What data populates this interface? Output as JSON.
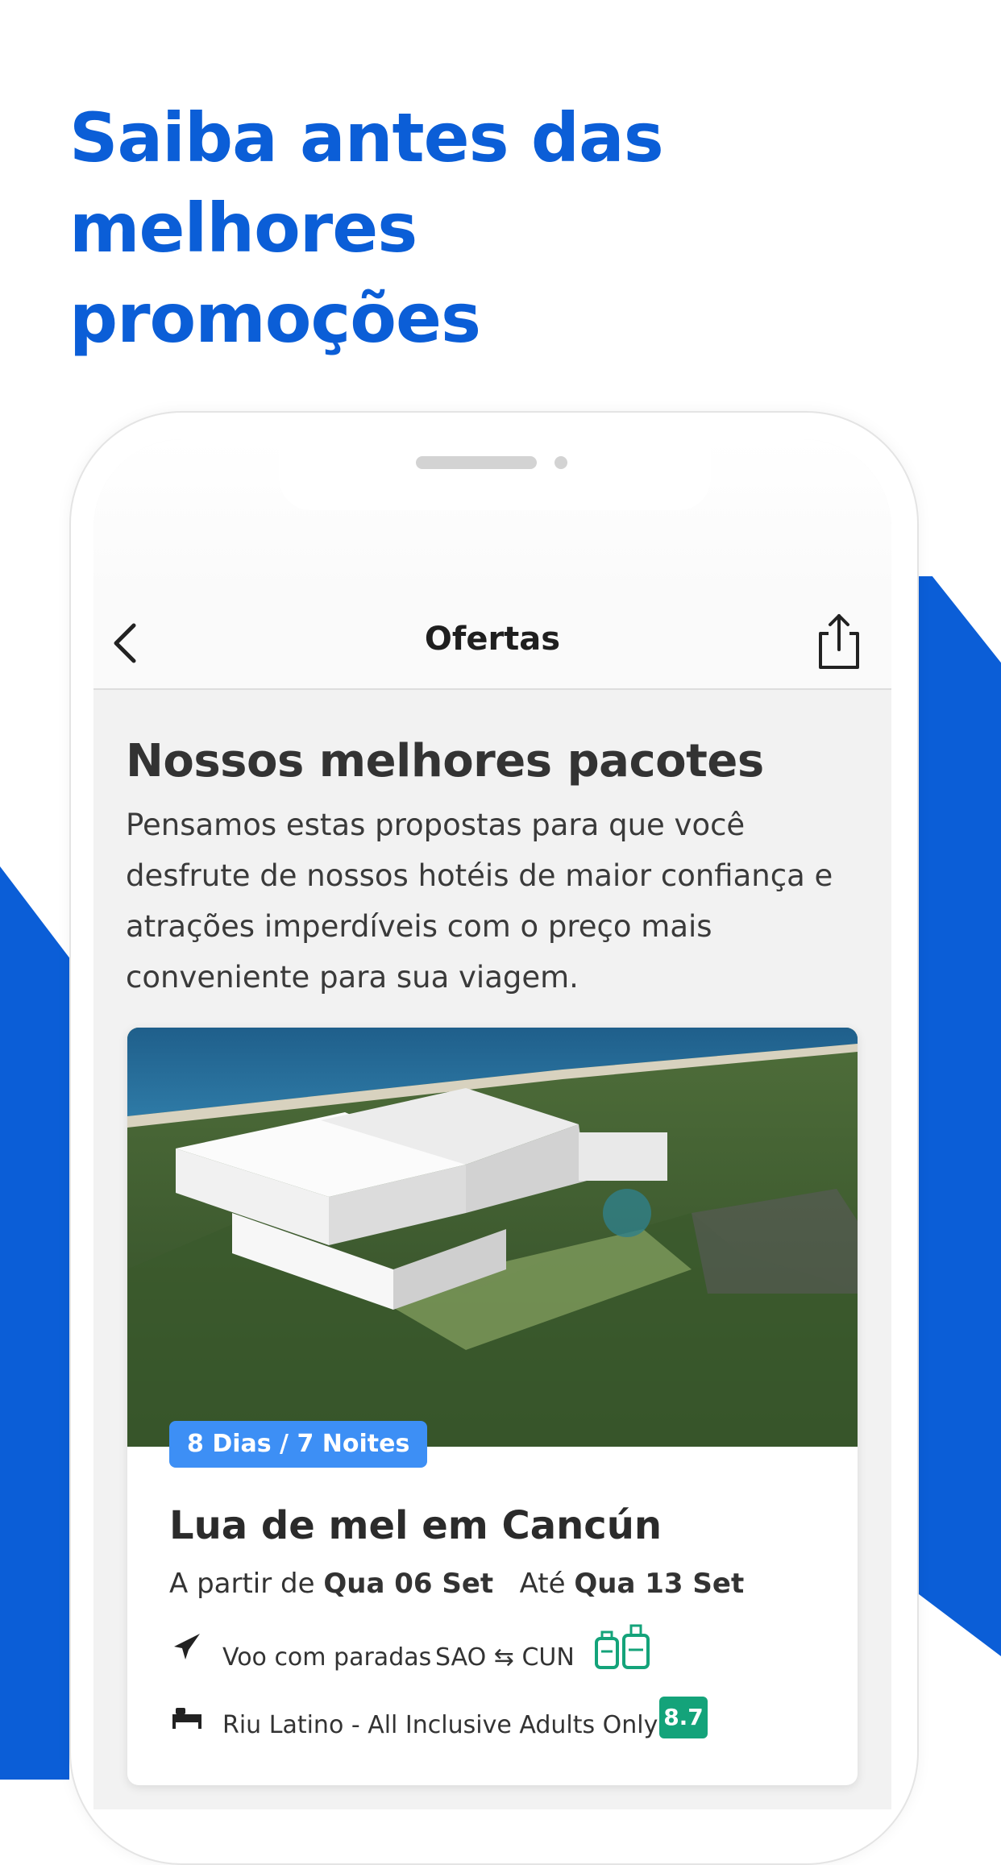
{
  "headline": {
    "line1": "Saiba antes das melhores",
    "line2": "promoções"
  },
  "colors": {
    "brand_blue": "#0b5ed7",
    "badge_blue": "#3d8ff5",
    "rating_green": "#14a37a"
  },
  "navbar": {
    "title": "Ofertas",
    "back_icon": "chevron-left-icon",
    "share_icon": "share-icon"
  },
  "section": {
    "title": "Nossos melhores pacotes",
    "description_lines": [
      "Pensamos estas propostas para que você",
      "desfrute de nossos hotéis de maior confiança e",
      "atrações imperdíveis com o preço mais",
      "conveniente para sua viagem."
    ]
  },
  "card": {
    "badge": "8 Dias / 7 Noites",
    "title": "Lua de mel em Cancún",
    "dates": {
      "from_label": "A partir de",
      "from_value": "Qua 06 Set",
      "to_label": "Até",
      "to_value": "Qua 13 Set"
    },
    "flight": {
      "icon": "airplane-icon",
      "label": "Voo com paradas",
      "origin": "SAO",
      "destination": "CUN",
      "route_icon": "round-trip-arrows-icon",
      "baggage_icon": "luggage-icon"
    },
    "hotel": {
      "icon": "bed-icon",
      "name": "Riu Latino - All Inclusive Adults Only",
      "rating": "8.7"
    }
  }
}
